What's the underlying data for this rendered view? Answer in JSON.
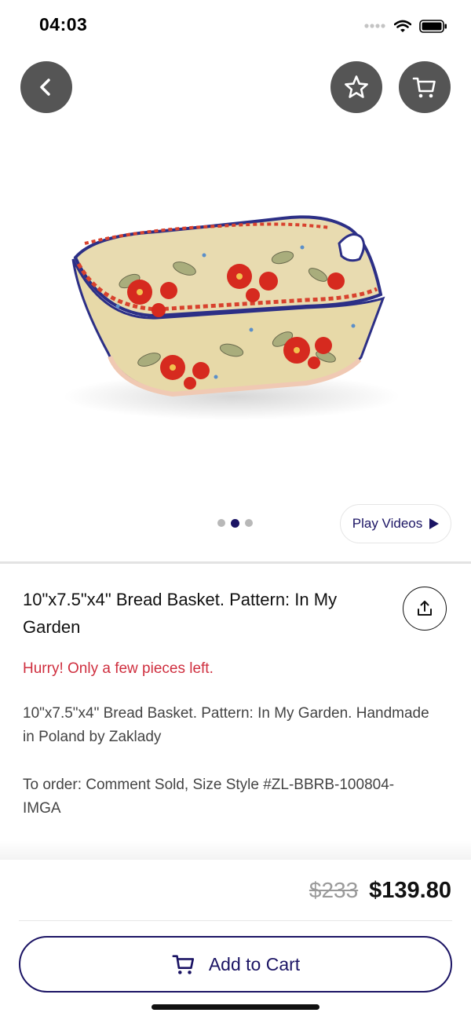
{
  "status_bar": {
    "time": "04:03"
  },
  "header": {
    "back_icon": "chevron-left-icon",
    "favorite_icon": "star-icon",
    "cart_icon": "cart-icon"
  },
  "gallery": {
    "image_alt": "Bread basket",
    "image_count": 3,
    "active_index": 1,
    "play_videos_label": "Play Videos"
  },
  "product": {
    "title": "10\"x7.5\"x4\" Bread Basket. Pattern: In My Garden",
    "stock_warning": "Hurry! Only a few pieces left.",
    "description_1": "10\"x7.5\"x4\" Bread Basket. Pattern: In My Garden. Handmade in Poland by Zaklady",
    "description_2": "To order: Comment Sold, Size Style #ZL-BBRB-100804-IMGA"
  },
  "pricing": {
    "original_price": "$233",
    "sale_price": "$139.80"
  },
  "actions": {
    "add_to_cart_label": "Add to Cart"
  },
  "colors": {
    "brand": "#1b1464",
    "warning": "#cf2f3f",
    "button_bg": "#555555"
  }
}
